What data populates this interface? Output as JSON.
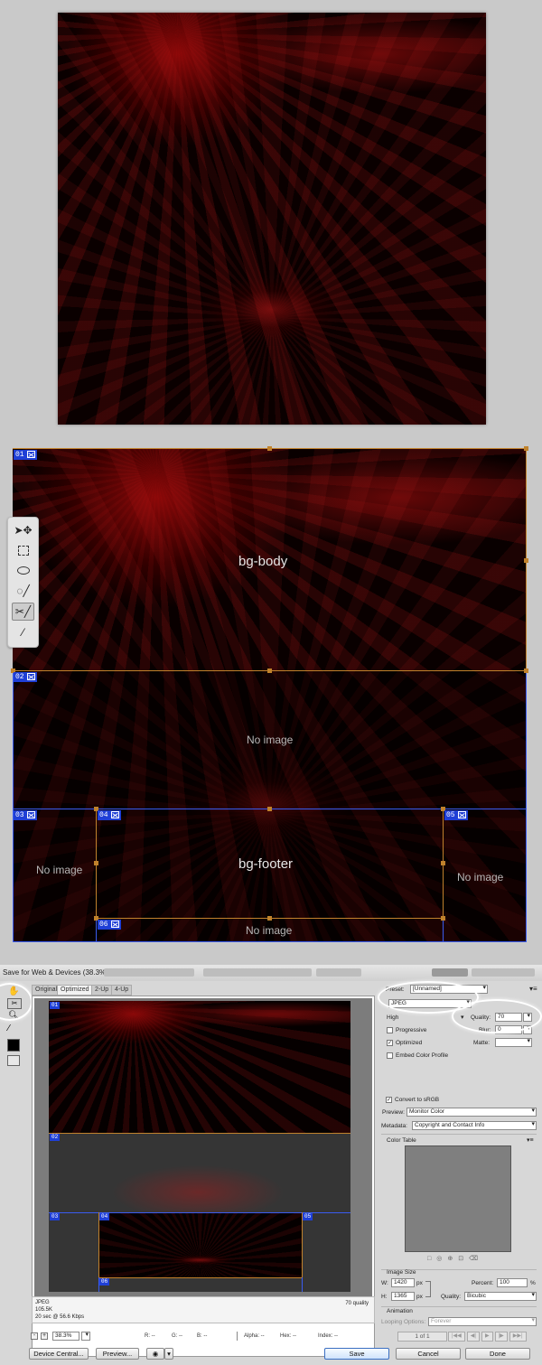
{
  "slices": {
    "tags": [
      "01",
      "02",
      "03",
      "04",
      "05",
      "06"
    ],
    "labels": {
      "bg_body": "bg-body",
      "no_image_02": "No image",
      "no_image_03": "No image",
      "bg_footer": "bg-footer",
      "no_image_05": "No image",
      "no_image_06": "No image"
    }
  },
  "toolbox": {
    "icons": [
      "slice-select-move-icon",
      "marquee-icon",
      "lasso-icon",
      "quick-select-icon",
      "slice-tool-icon",
      "eyedropper-icon"
    ]
  },
  "dialog": {
    "title": "Save for Web & Devices (38.3%)",
    "tabs": [
      "Original",
      "Optimized",
      "2-Up",
      "4-Up"
    ],
    "active_tab": "Optimized",
    "status_left": [
      "JPEG",
      "105.5K",
      "20 sec @ 56.6 Kbps"
    ],
    "status_right": "70 quality",
    "zoom": "38.3%",
    "readouts": {
      "r": "R: --",
      "g": "G: --",
      "b": "B: --",
      "alpha": "Alpha: --",
      "hex": "Hex: --",
      "index": "Index: --"
    },
    "buttons": {
      "device_central": "Device Central...",
      "preview": "Preview...",
      "save": "Save",
      "cancel": "Cancel",
      "done": "Done"
    },
    "panel": {
      "preset_label": "Preset:",
      "preset_value": "[Unnamed]",
      "format_value": "JPEG",
      "compression_value": "High",
      "quality_label": "Quality:",
      "quality_value": "70",
      "progressive_label": "Progressive",
      "blur_label": "Blur:",
      "blur_value": "0",
      "optimized_label": "Optimized",
      "matte_label": "Matte:",
      "embed_profile_label": "Embed Color Profile",
      "convert_srgb_label": "Convert to sRGB",
      "preview_label": "Preview:",
      "preview_value": "Monitor Color",
      "metadata_label": "Metadata:",
      "metadata_value": "Copyright and Contact Info",
      "color_table_label": "Color Table",
      "image_size_label": "Image Size",
      "w_label": "W:",
      "w_value": "1420",
      "h_label": "H:",
      "h_value": "1365",
      "px": "px",
      "percent_label": "Percent:",
      "percent_value": "100",
      "percent_unit": "%",
      "resample_label": "Quality:",
      "resample_value": "Bicubic",
      "animation_label": "Animation",
      "looping_label": "Looping Options:",
      "looping_value": "Forever",
      "frame_counter": "1 of 1"
    }
  }
}
